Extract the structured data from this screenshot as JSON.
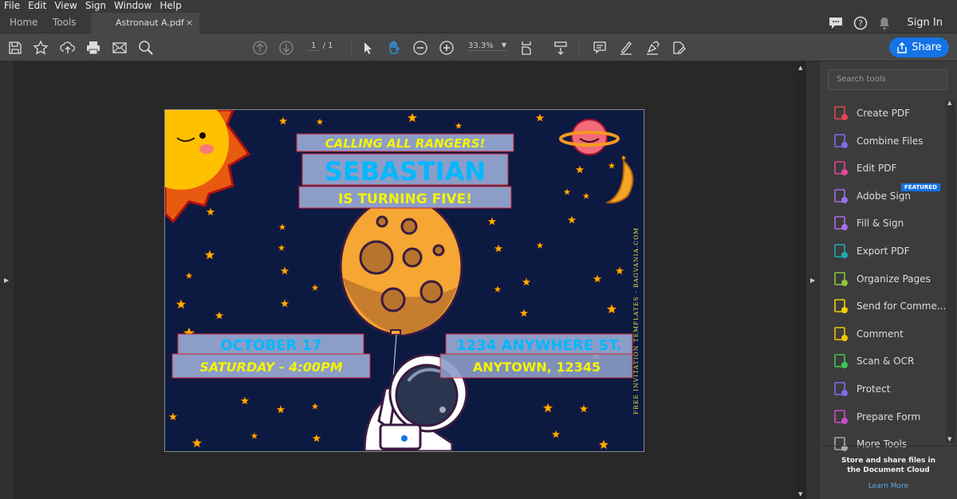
{
  "menu": [
    "File",
    "Edit",
    "View",
    "Sign",
    "Window",
    "Help"
  ],
  "tabs": {
    "home": "Home",
    "tools": "Tools",
    "document": "Astronaut A.pdf",
    "close": "×"
  },
  "header": {
    "sign_in": "Sign In"
  },
  "toolbar": {
    "page_current": "1",
    "page_total": "/ 1",
    "zoom": "33.3%",
    "share": "Share"
  },
  "document": {
    "headline": "CALLING ALL RANGERS!",
    "name": "SEBASTIAN",
    "subline": "IS TURNING FIVE!",
    "date": "OCTOBER 17",
    "time": "SATURDAY - 4:00PM",
    "address1": "1234 ANYWHERE ST.",
    "address2": "ANYTOWN, 12345",
    "watermark": "FREE INVITATION TEMPLATES - BAGVANIA.COM"
  },
  "tools_panel": {
    "search_placeholder": "Search tools",
    "featured": "FEATURED",
    "items": [
      {
        "label": "Create PDF",
        "icon": "create-pdf-icon",
        "color": "#e34850"
      },
      {
        "label": "Combine Files",
        "icon": "combine-files-icon",
        "color": "#7d6ee8"
      },
      {
        "label": "Edit PDF",
        "icon": "edit-pdf-icon",
        "color": "#e34895"
      },
      {
        "label": "Adobe Sign",
        "icon": "adobe-sign-icon",
        "color": "#9e6ee8"
      },
      {
        "label": "Fill & Sign",
        "icon": "fill-sign-icon",
        "color": "#a86ee8"
      },
      {
        "label": "Export PDF",
        "icon": "export-pdf-icon",
        "color": "#1fa8b8"
      },
      {
        "label": "Organize Pages",
        "icon": "organize-pages-icon",
        "color": "#8cc63f"
      },
      {
        "label": "Send for Comme...",
        "icon": "send-for-comment-icon",
        "color": "#f0d000"
      },
      {
        "label": "Comment",
        "icon": "comment-icon",
        "color": "#f0c400"
      },
      {
        "label": "Scan & OCR",
        "icon": "scan-ocr-icon",
        "color": "#3fc651"
      },
      {
        "label": "Protect",
        "icon": "protect-icon",
        "color": "#7d6ee8"
      },
      {
        "label": "Prepare Form",
        "icon": "prepare-form-icon",
        "color": "#c94fc9"
      },
      {
        "label": "More Tools",
        "icon": "more-tools-icon",
        "color": "#aaaaaa"
      }
    ],
    "cloud_text": "Store and share files in the Document Cloud",
    "learn_more": "Learn More"
  },
  "colors": {
    "accent": "#1473e6",
    "navy": "#0c1a42",
    "yellow": "#f5f500",
    "cyan": "#00b8ff"
  }
}
